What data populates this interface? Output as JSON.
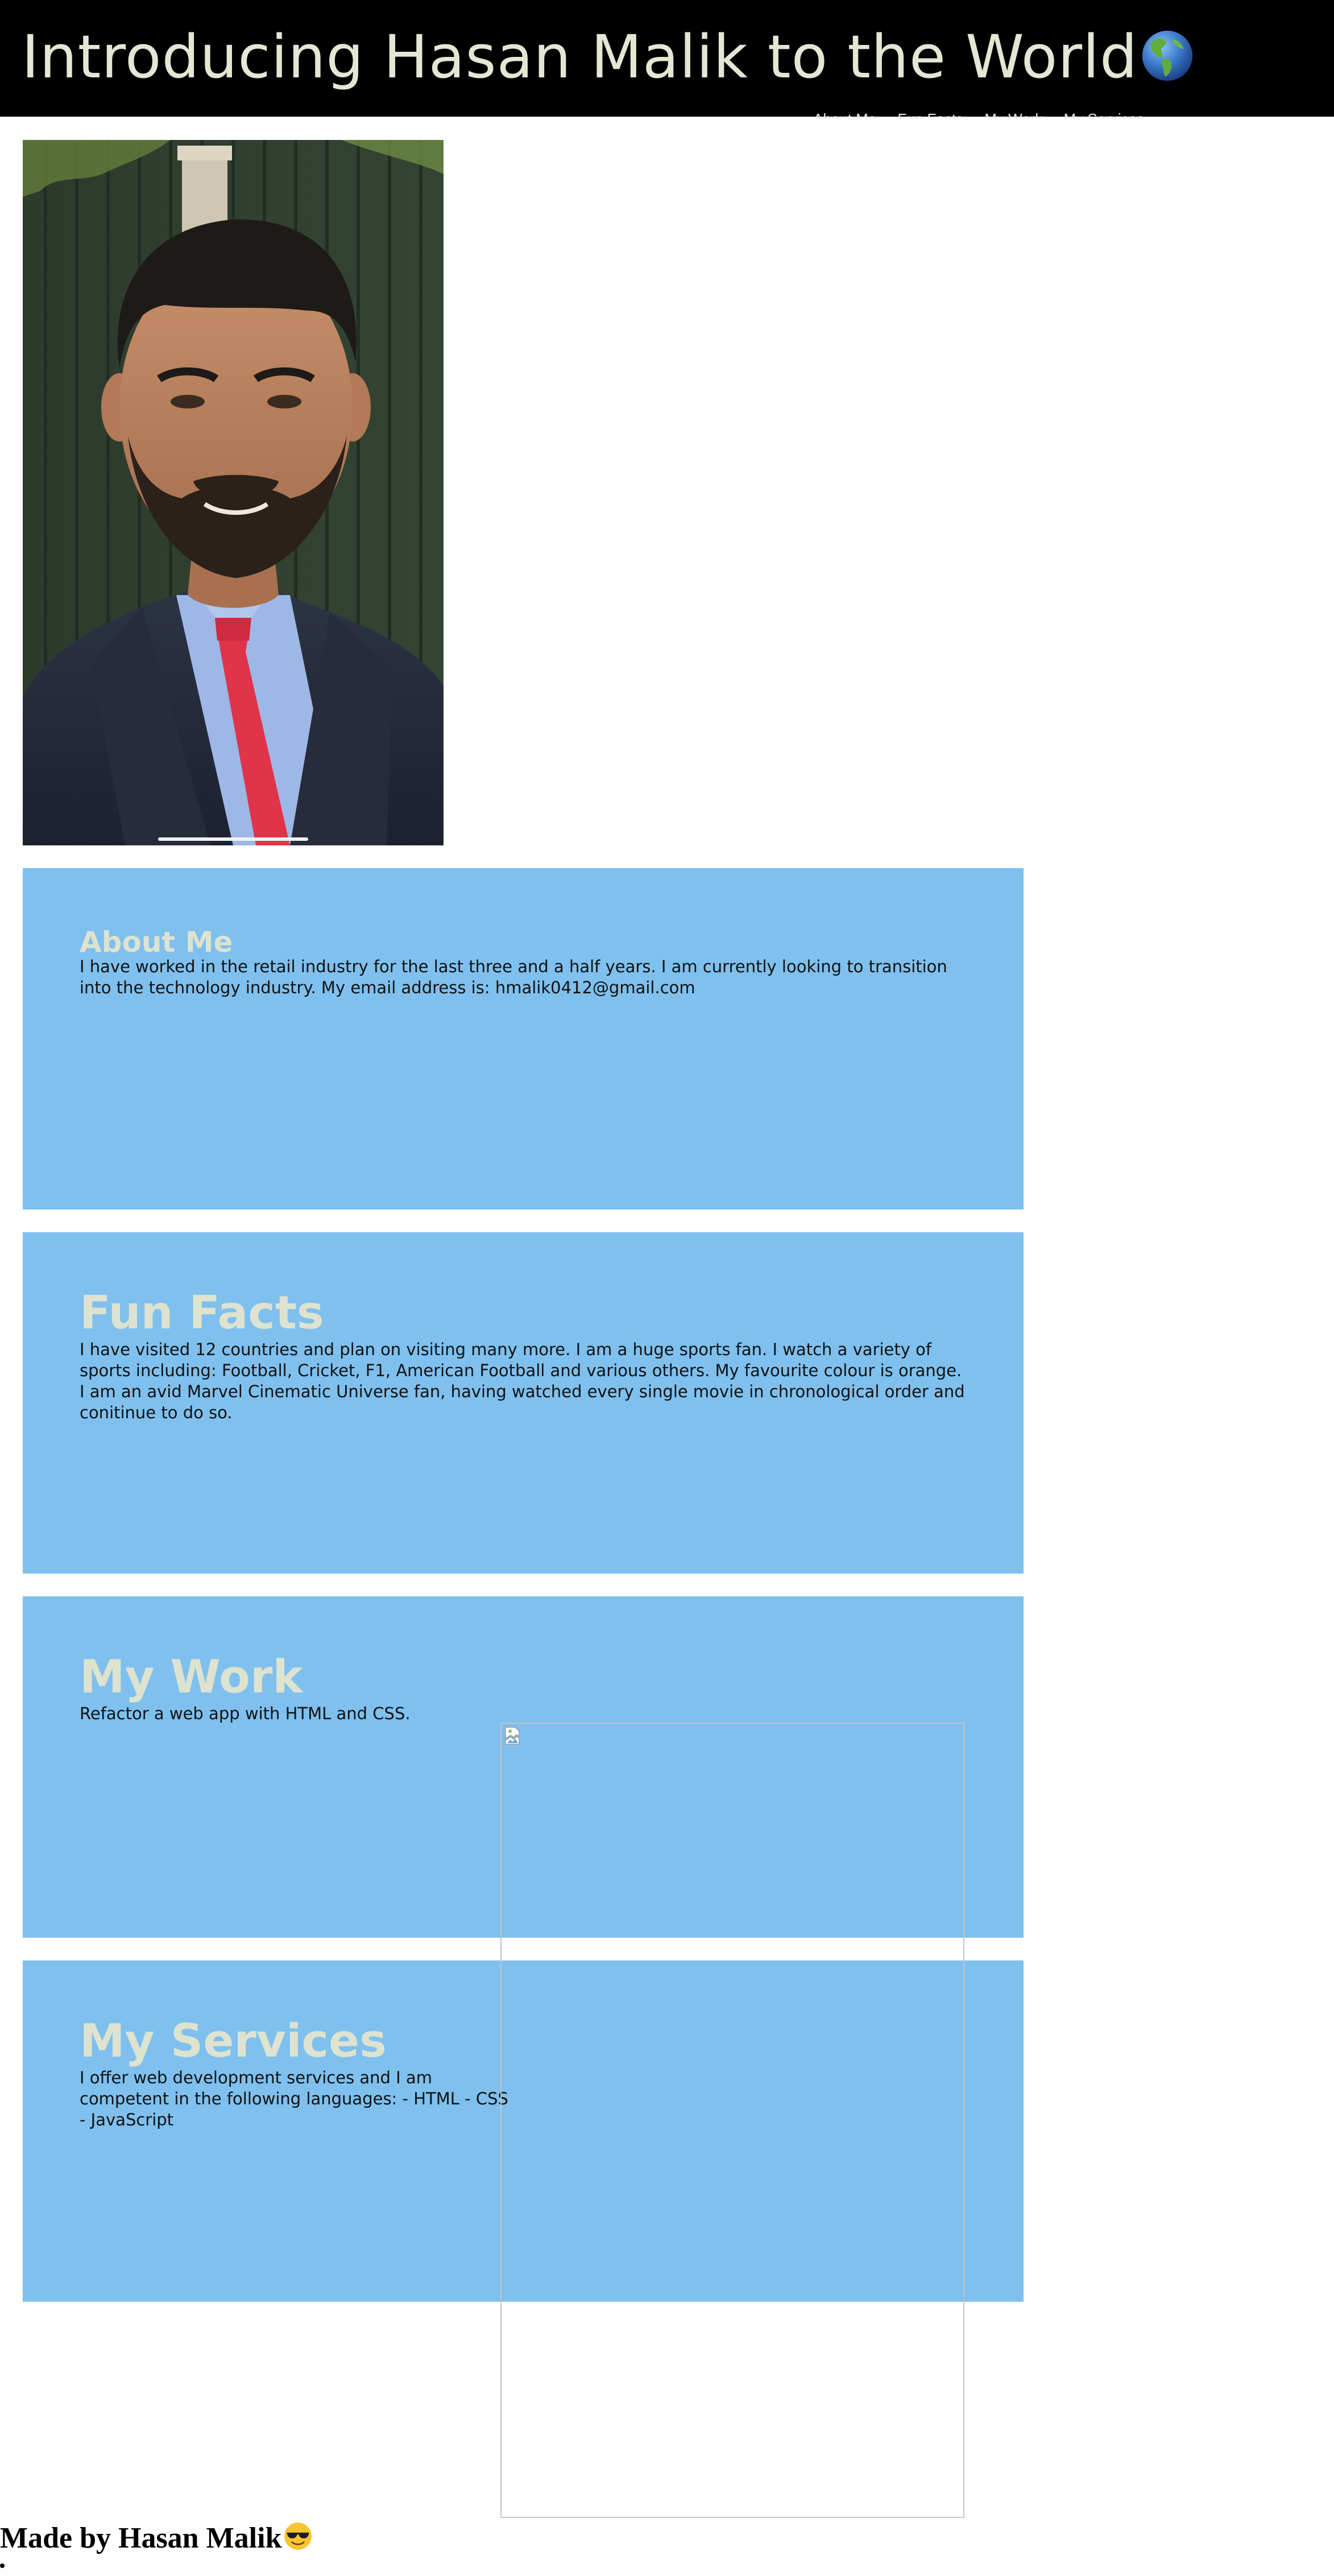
{
  "header": {
    "title": "Introducing Hasan Malik to the World",
    "title_icon": "globe-americas-icon",
    "background": "#000000",
    "title_color": "#e3e7d3"
  },
  "nav": {
    "items": [
      "About Me",
      "Fun Facts",
      "My Work",
      "My Services"
    ]
  },
  "profile": {
    "photo": "portrait-photo"
  },
  "sections": {
    "about": {
      "heading": "About Me",
      "body": "I have worked in the retail industry for the last three and a half years. I am currently looking to transition into the technology industry. My email address is: hmalik0412@gmail.com"
    },
    "facts": {
      "heading": "Fun Facts",
      "body": "I have visited 12 countries and plan on visiting many more. I am a huge sports fan. I watch a variety of sports including: Football, Cricket, F1, American Football and various others. My favourite colour is orange. I am an avid Marvel Cinematic Universe fan, having watched every single movie in chronological order and conitinue to do so."
    },
    "work": {
      "heading": "My Work",
      "body": "Refactor a web app with HTML and CSS."
    },
    "services": {
      "heading": "My Services",
      "body": "I offer web development services and I am competent in the following languages: - HTML - CSS - JavaScript"
    },
    "background": "#7fc0ee",
    "heading_color": "#dde3cf"
  },
  "footer": {
    "text": "Made by Hasan Malik",
    "icon": "sunglasses-face-icon"
  }
}
